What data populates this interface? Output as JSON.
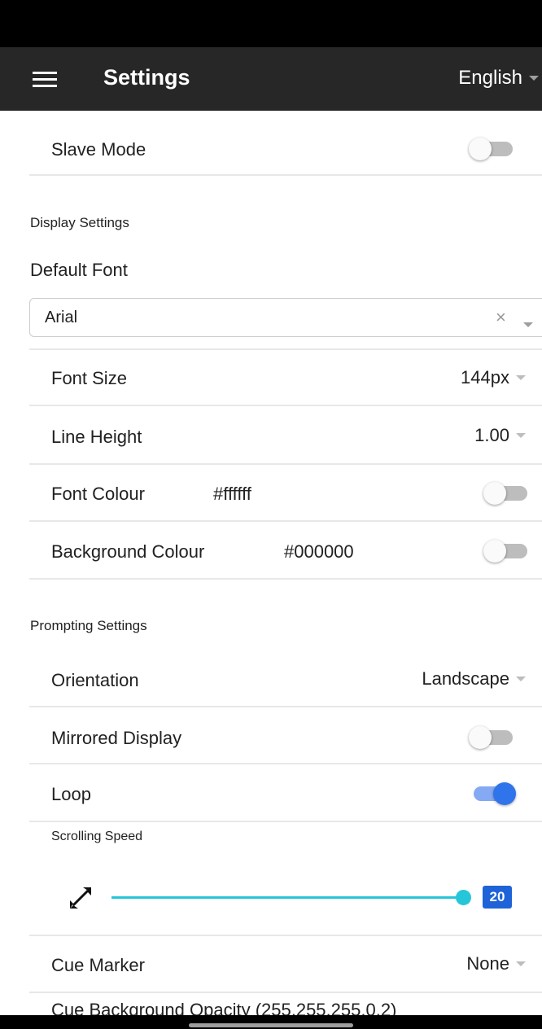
{
  "app_bar": {
    "title": "Settings",
    "language": "English",
    "menu_icon": "hamburger-menu-icon"
  },
  "slave_mode": {
    "label": "Slave Mode",
    "enabled": false
  },
  "display_settings": {
    "section_title": "Display Settings",
    "default_font": {
      "label": "Default Font",
      "value": "Arial",
      "clear_glyph": "×"
    },
    "font_size": {
      "label": "Font Size",
      "value": "144px"
    },
    "line_height": {
      "label": "Line Height",
      "value": "1.00"
    },
    "font_colour": {
      "label": "Font Colour",
      "value": "#ffffff",
      "enabled": false
    },
    "background_colour": {
      "label": "Background Colour",
      "value": "#000000",
      "enabled": false
    }
  },
  "prompting_settings": {
    "section_title": "Prompting Settings",
    "orientation": {
      "label": "Orientation",
      "value": "Landscape"
    },
    "mirrored_display": {
      "label": "Mirrored Display",
      "enabled": false
    },
    "loop": {
      "label": "Loop",
      "enabled": true
    },
    "scrolling_speed": {
      "label": "Scrolling Speed",
      "value": "20",
      "max_fraction": 1.0,
      "icon": "expand-arrows-icon"
    },
    "cue_marker": {
      "label": "Cue Marker",
      "value": "None"
    },
    "partial_row_text": "Cue Background Opacity (255,255,255,0.2)"
  },
  "colors": {
    "app_bar_bg": "#272727",
    "toggle_on": "#2f74ea",
    "slider": "#26c6da",
    "badge": "#1e63d8"
  }
}
